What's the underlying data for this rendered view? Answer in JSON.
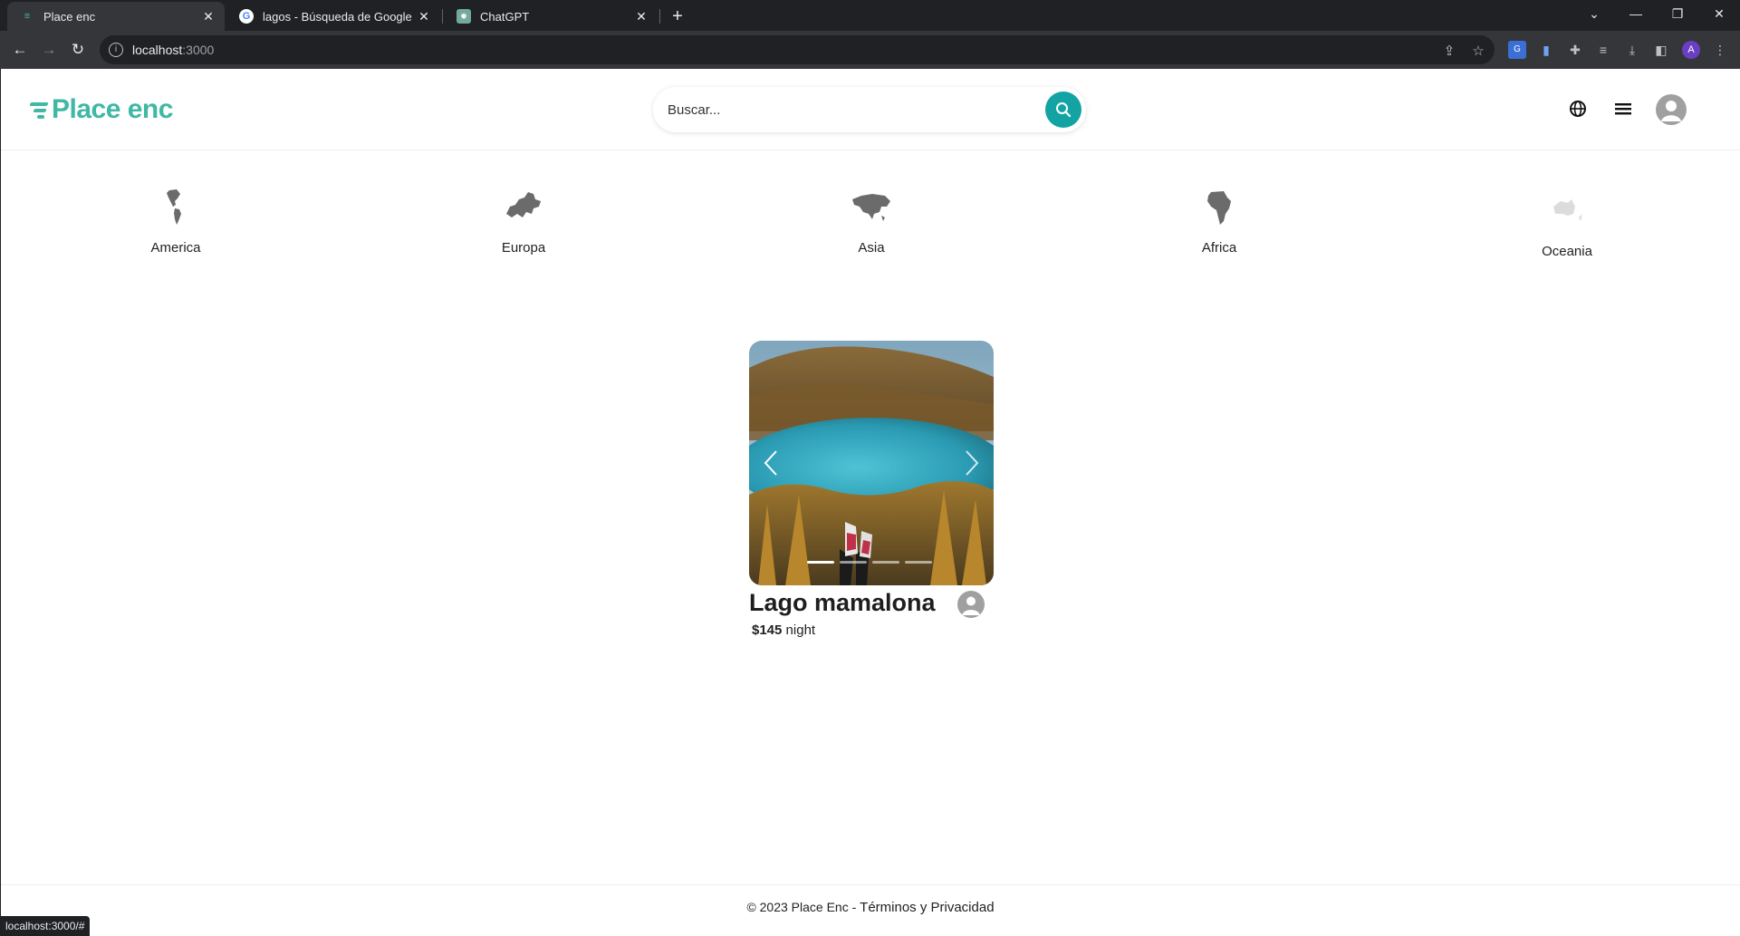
{
  "browser": {
    "tabs": [
      {
        "title": "Place enc",
        "favicon": "place-enc-icon",
        "active": true
      },
      {
        "title": "lagos - Búsqueda de Google",
        "favicon": "google-icon",
        "active": false
      },
      {
        "title": "ChatGPT",
        "favicon": "chatgpt-icon",
        "active": false
      }
    ],
    "url_host": "localhost",
    "url_port": ":3000",
    "profile_initial": "A",
    "status_url": "localhost:3000/#"
  },
  "header": {
    "logo_text": "Place enc",
    "brand_color": "#3fb8a4",
    "search_placeholder": "Buscar...",
    "search_button_color": "#14a3a3"
  },
  "regions": [
    {
      "label": "America",
      "icon": "americas-map-icon"
    },
    {
      "label": "Europa",
      "icon": "europe-map-icon"
    },
    {
      "label": "Asia",
      "icon": "asia-map-icon"
    },
    {
      "label": "Africa",
      "icon": "africa-map-icon"
    },
    {
      "label": "Oceania",
      "icon": "oceania-map-icon"
    }
  ],
  "listing": {
    "title": "Lago mamalona",
    "price": "$145",
    "price_unit": "night",
    "carousel_slides": 4,
    "active_slide": 1
  },
  "footer": {
    "text": "© 2023 Place Enc - ",
    "link": "Términos y Privacidad"
  }
}
